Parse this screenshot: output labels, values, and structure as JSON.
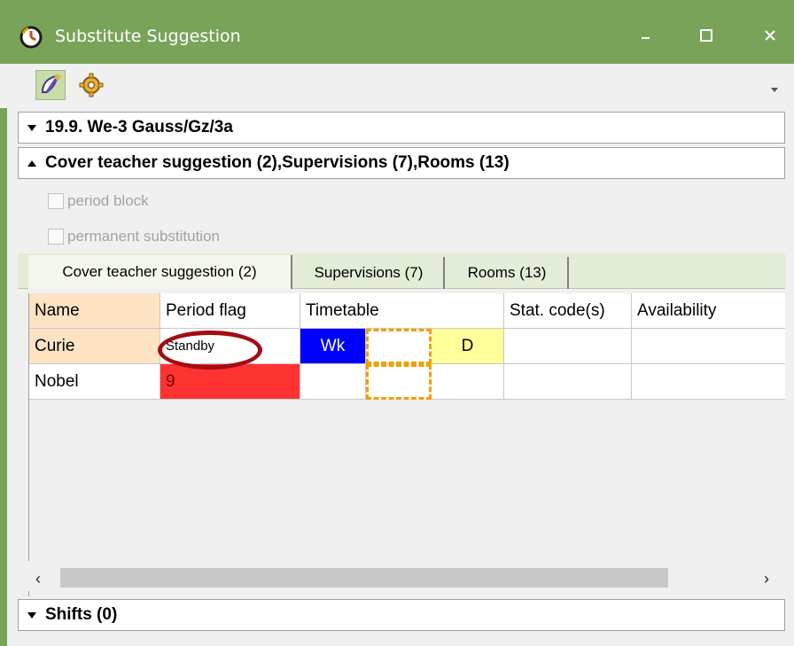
{
  "window": {
    "title": "Substitute Suggestion",
    "title_bar_color": "#7aa35a",
    "controls": [
      "minimize",
      "maximize",
      "close"
    ]
  },
  "toolbar": {
    "buttons": [
      {
        "icon": "edit-brush-icon",
        "pressed": true
      },
      {
        "icon": "settings-gear-icon",
        "pressed": false
      }
    ]
  },
  "sections": {
    "lesson": {
      "label": "19.9. We-3 Gauss/Gz/3a",
      "expanded": false
    },
    "suggestions": {
      "label": "Cover teacher suggestion (2),Supervisions (7),Rooms (13)",
      "expanded": true
    },
    "shifts": {
      "label": "Shifts (0)",
      "expanded": false
    }
  },
  "options": {
    "period_block": {
      "label": "period block",
      "checked": false,
      "enabled": false
    },
    "permanent_substitution": {
      "label": "permanent substitution",
      "checked": false,
      "enabled": false
    }
  },
  "tabs": [
    {
      "label": "Cover teacher suggestion (2)",
      "active": true
    },
    {
      "label": "Supervisions (7)",
      "active": false
    },
    {
      "label": "Rooms (13)",
      "active": false
    }
  ],
  "table": {
    "columns": [
      "Name",
      "Period flag",
      "Timetable",
      "Stat. code(s)",
      "Availability"
    ],
    "rows": [
      {
        "name": "Curie",
        "period_flag": "Standby",
        "timetable": [
          "Wk",
          "",
          "D"
        ],
        "stat_codes": "",
        "availability": ""
      },
      {
        "name": "Nobel",
        "period_flag": "9",
        "timetable": [
          "",
          "",
          ""
        ],
        "stat_codes": "",
        "availability": ""
      }
    ]
  },
  "colors": {
    "accent": "#7aa35a",
    "name_cell": "#fde3c4",
    "timetable_wk": "#0000ff",
    "timetable_d": "#ffff99",
    "flag_red": "#ff3232",
    "highlight_ring": "#a30d12"
  }
}
